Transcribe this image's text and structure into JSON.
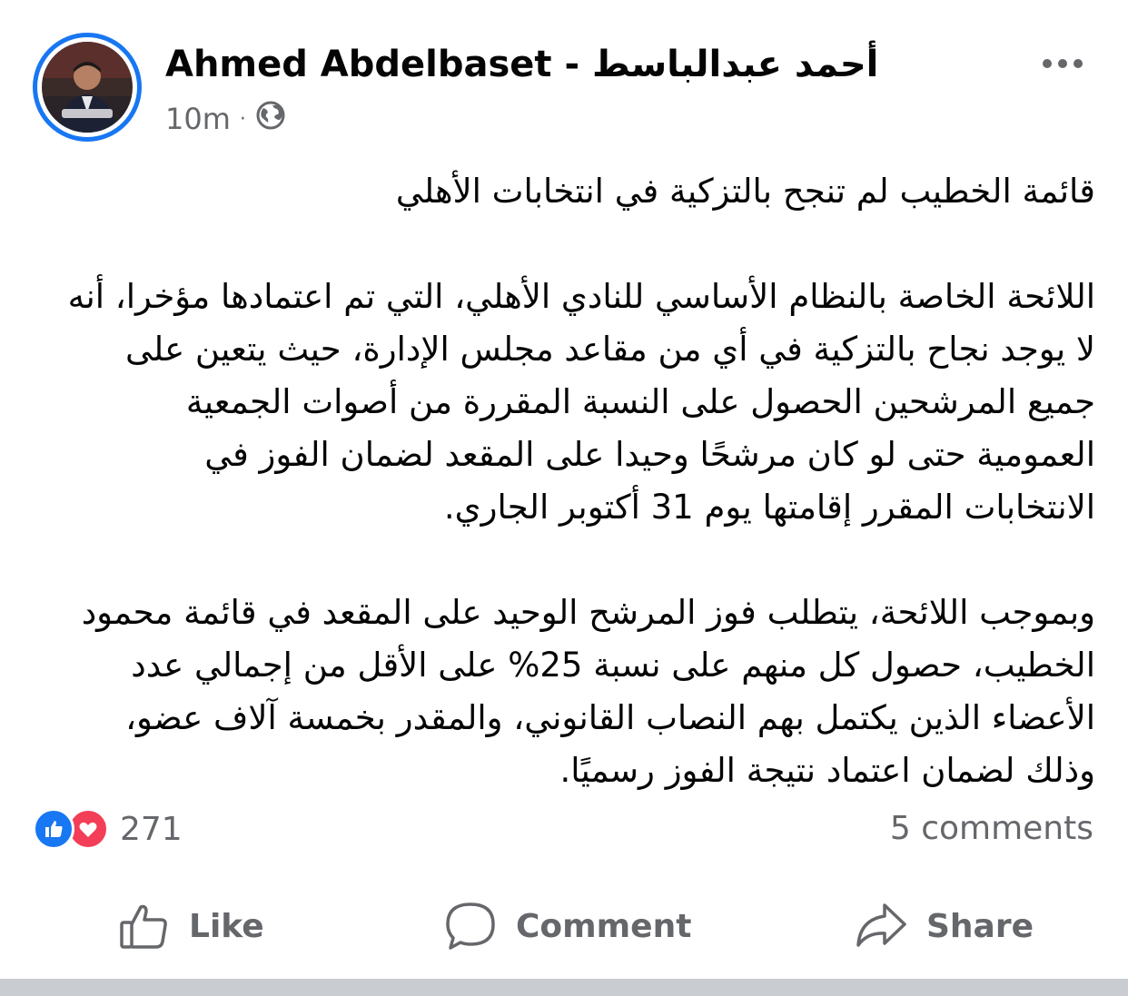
{
  "post": {
    "author_name": "Ahmed Abdelbaset - أحمد عبدالباسط",
    "timestamp": "10m",
    "separator": "·",
    "audience_icon": "globe-icon",
    "more_icon": "more-horizontal-icon",
    "paragraphs": [
      "قائمة الخطيب لم تنجح بالتزكية في انتخابات الأهلي",
      "اللائحة الخاصة بالنظام الأساسي للنادي الأهلي، التي تم اعتمادها مؤخرا، أنه لا يوجد نجاح بالتزكية في أي من مقاعد مجلس الإدارة، حيث يتعين على جميع المرشحين الحصول على النسبة المقررة من أصوات الجمعية العمومية حتى لو كان مرشحًا وحيدا على المقعد لضمان الفوز في الانتخابات المقرر إقامتها يوم 31 أكتوبر الجاري.",
      "وبموجب اللائحة، يتطلب فوز المرشح الوحيد على المقعد في قائمة محمود الخطيب، حصول كل منهم على نسبة 25% على الأقل من إجمالي عدد الأعضاء الذين يكتمل بهم النصاب القانوني، والمقدر بخمسة آلاف عضو، وذلك لضمان اعتماد نتيجة الفوز رسميًا."
    ]
  },
  "reactions": {
    "count": "271",
    "types": [
      "like-icon",
      "love-icon"
    ],
    "like_color": "#1877f2",
    "love_color": "#f33e58"
  },
  "comments": {
    "label": "5 comments"
  },
  "actions": {
    "like": "Like",
    "comment": "Comment",
    "share": "Share"
  },
  "colors": {
    "accent": "#1877f2",
    "secondary_text": "#65676b",
    "primary_text": "#050505"
  }
}
